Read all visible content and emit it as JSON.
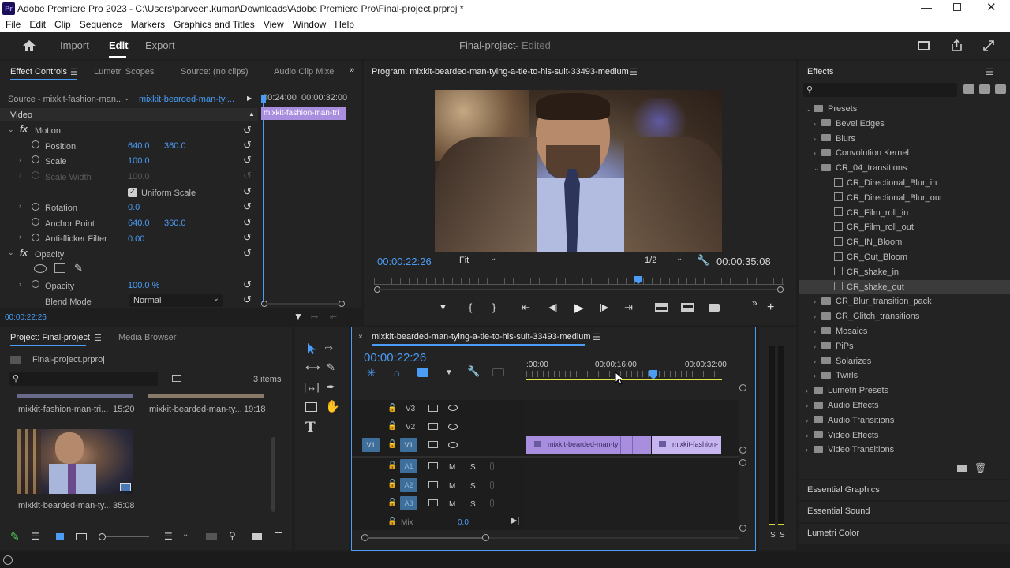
{
  "window": {
    "title": "Adobe Premiere Pro 2023 - C:\\Users\\parveen.kumar\\Downloads\\Adobe Premiere Pro\\Final-project.prproj *",
    "app_badge": "Pr"
  },
  "menu": [
    "File",
    "Edit",
    "Clip",
    "Sequence",
    "Markers",
    "Graphics and Titles",
    "View",
    "Window",
    "Help"
  ],
  "workspace": {
    "tabs": [
      "Import",
      "Edit",
      "Export"
    ],
    "active": "Edit",
    "project_title": "Final-project",
    "status": "- Edited"
  },
  "effect_controls": {
    "tabs": [
      "Effect Controls",
      "Lumetri Scopes",
      "Source: (no clips)",
      "Audio Clip Mixe"
    ],
    "source_label": "Source - mixkit-fashion-man...",
    "clip_link": "mixkit-bearded-man-tyi...",
    "ruler": [
      "00:24:00",
      "00:00:32:00"
    ],
    "clip_bar": "mixkit-fashion-man-tri",
    "video_header": "Video",
    "motion": "Motion",
    "position": {
      "label": "Position",
      "x": "640.0",
      "y": "360.0"
    },
    "scale": {
      "label": "Scale",
      "value": "100.0"
    },
    "scale_width": {
      "label": "Scale Width",
      "value": "100.0"
    },
    "uniform_scale": "Uniform Scale",
    "rotation": {
      "label": "Rotation",
      "value": "0.0"
    },
    "anchor": {
      "label": "Anchor Point",
      "x": "640.0",
      "y": "360.0"
    },
    "antiflicker": {
      "label": "Anti-flicker Filter",
      "value": "0.00"
    },
    "opacity_group": "Opacity",
    "opacity": {
      "label": "Opacity",
      "value": "100.0 %"
    },
    "blend": {
      "label": "Blend Mode",
      "value": "Normal"
    },
    "timecode": "00:00:22:26"
  },
  "program": {
    "title": "Program: mixkit-bearded-man-tying-a-tie-to-his-suit-33493-medium",
    "timecode": "00:00:22:26",
    "fit": "Fit",
    "quality": "1/2",
    "duration": "00:00:35:08",
    "playhead_fraction": 0.65
  },
  "effects": {
    "title": "Effects",
    "tree": [
      {
        "label": "Presets",
        "level": 0,
        "kind": "folder",
        "open": true
      },
      {
        "label": "Bevel Edges",
        "level": 1,
        "kind": "folder"
      },
      {
        "label": "Blurs",
        "level": 1,
        "kind": "folder"
      },
      {
        "label": "Convolution Kernel",
        "level": 1,
        "kind": "folder"
      },
      {
        "label": "CR_04_transitions",
        "level": 1,
        "kind": "folder",
        "open": true
      },
      {
        "label": "CR_Directional_Blur_in",
        "level": 2,
        "kind": "preset"
      },
      {
        "label": "CR_Directional_Blur_out",
        "level": 2,
        "kind": "preset"
      },
      {
        "label": "CR_Film_roll_in",
        "level": 2,
        "kind": "preset"
      },
      {
        "label": "CR_Film_roll_out",
        "level": 2,
        "kind": "preset"
      },
      {
        "label": "CR_IN_Bloom",
        "level": 2,
        "kind": "preset"
      },
      {
        "label": "CR_Out_Bloom",
        "level": 2,
        "kind": "preset"
      },
      {
        "label": "CR_shake_in",
        "level": 2,
        "kind": "preset"
      },
      {
        "label": "CR_shake_out",
        "level": 2,
        "kind": "preset",
        "selected": true
      },
      {
        "label": "CR_Blur_transition_pack",
        "level": 1,
        "kind": "folder"
      },
      {
        "label": "CR_Glitch_transitions",
        "level": 1,
        "kind": "folder"
      },
      {
        "label": "Mosaics",
        "level": 1,
        "kind": "folder"
      },
      {
        "label": "PiPs",
        "level": 1,
        "kind": "folder"
      },
      {
        "label": "Solarizes",
        "level": 1,
        "kind": "folder"
      },
      {
        "label": "Twirls",
        "level": 1,
        "kind": "folder"
      },
      {
        "label": "Lumetri Presets",
        "level": 0,
        "kind": "folder"
      },
      {
        "label": "Audio Effects",
        "level": 0,
        "kind": "folder"
      },
      {
        "label": "Audio Transitions",
        "level": 0,
        "kind": "folder"
      },
      {
        "label": "Video Effects",
        "level": 0,
        "kind": "folder"
      },
      {
        "label": "Video Transitions",
        "level": 0,
        "kind": "folder"
      }
    ],
    "sections": [
      "Essential Graphics",
      "Essential Sound",
      "Lumetri Color"
    ]
  },
  "project": {
    "tabs": [
      "Project: Final-project",
      "Media Browser"
    ],
    "file": "Final-project.prproj",
    "items_count": "3 items",
    "items": [
      {
        "name": "mixkit-fashion-man-tri...",
        "duration": "15:20"
      },
      {
        "name": "mixkit-bearded-man-ty...",
        "duration": "19:18"
      },
      {
        "name": "mixkit-bearded-man-ty...",
        "duration": "35:08"
      }
    ]
  },
  "timeline": {
    "title": "mixkit-bearded-man-tying-a-tie-to-his-suit-33493-medium",
    "timecode": "00:00:22:26",
    "ruler": [
      ":00:00",
      "00:00:16:00",
      "00:00:32:00"
    ],
    "tracks": {
      "video": [
        "V3",
        "V2",
        "V1"
      ],
      "audio": [
        "A1",
        "A2",
        "A3"
      ],
      "src_patch": "V1",
      "m": "M",
      "s": "S"
    },
    "mix": {
      "label": "Mix",
      "value": "0.0"
    },
    "clips": [
      "mixkit-bearded-man-tyi",
      "mixkit-fashion-"
    ]
  },
  "meters": {
    "labels": [
      "S",
      "S"
    ]
  },
  "colors": {
    "accent": "#4a9cf5",
    "clip": "#a98ee0",
    "clip_fashion": "#c7b5ef",
    "track_blue": "#3e6f9a"
  }
}
